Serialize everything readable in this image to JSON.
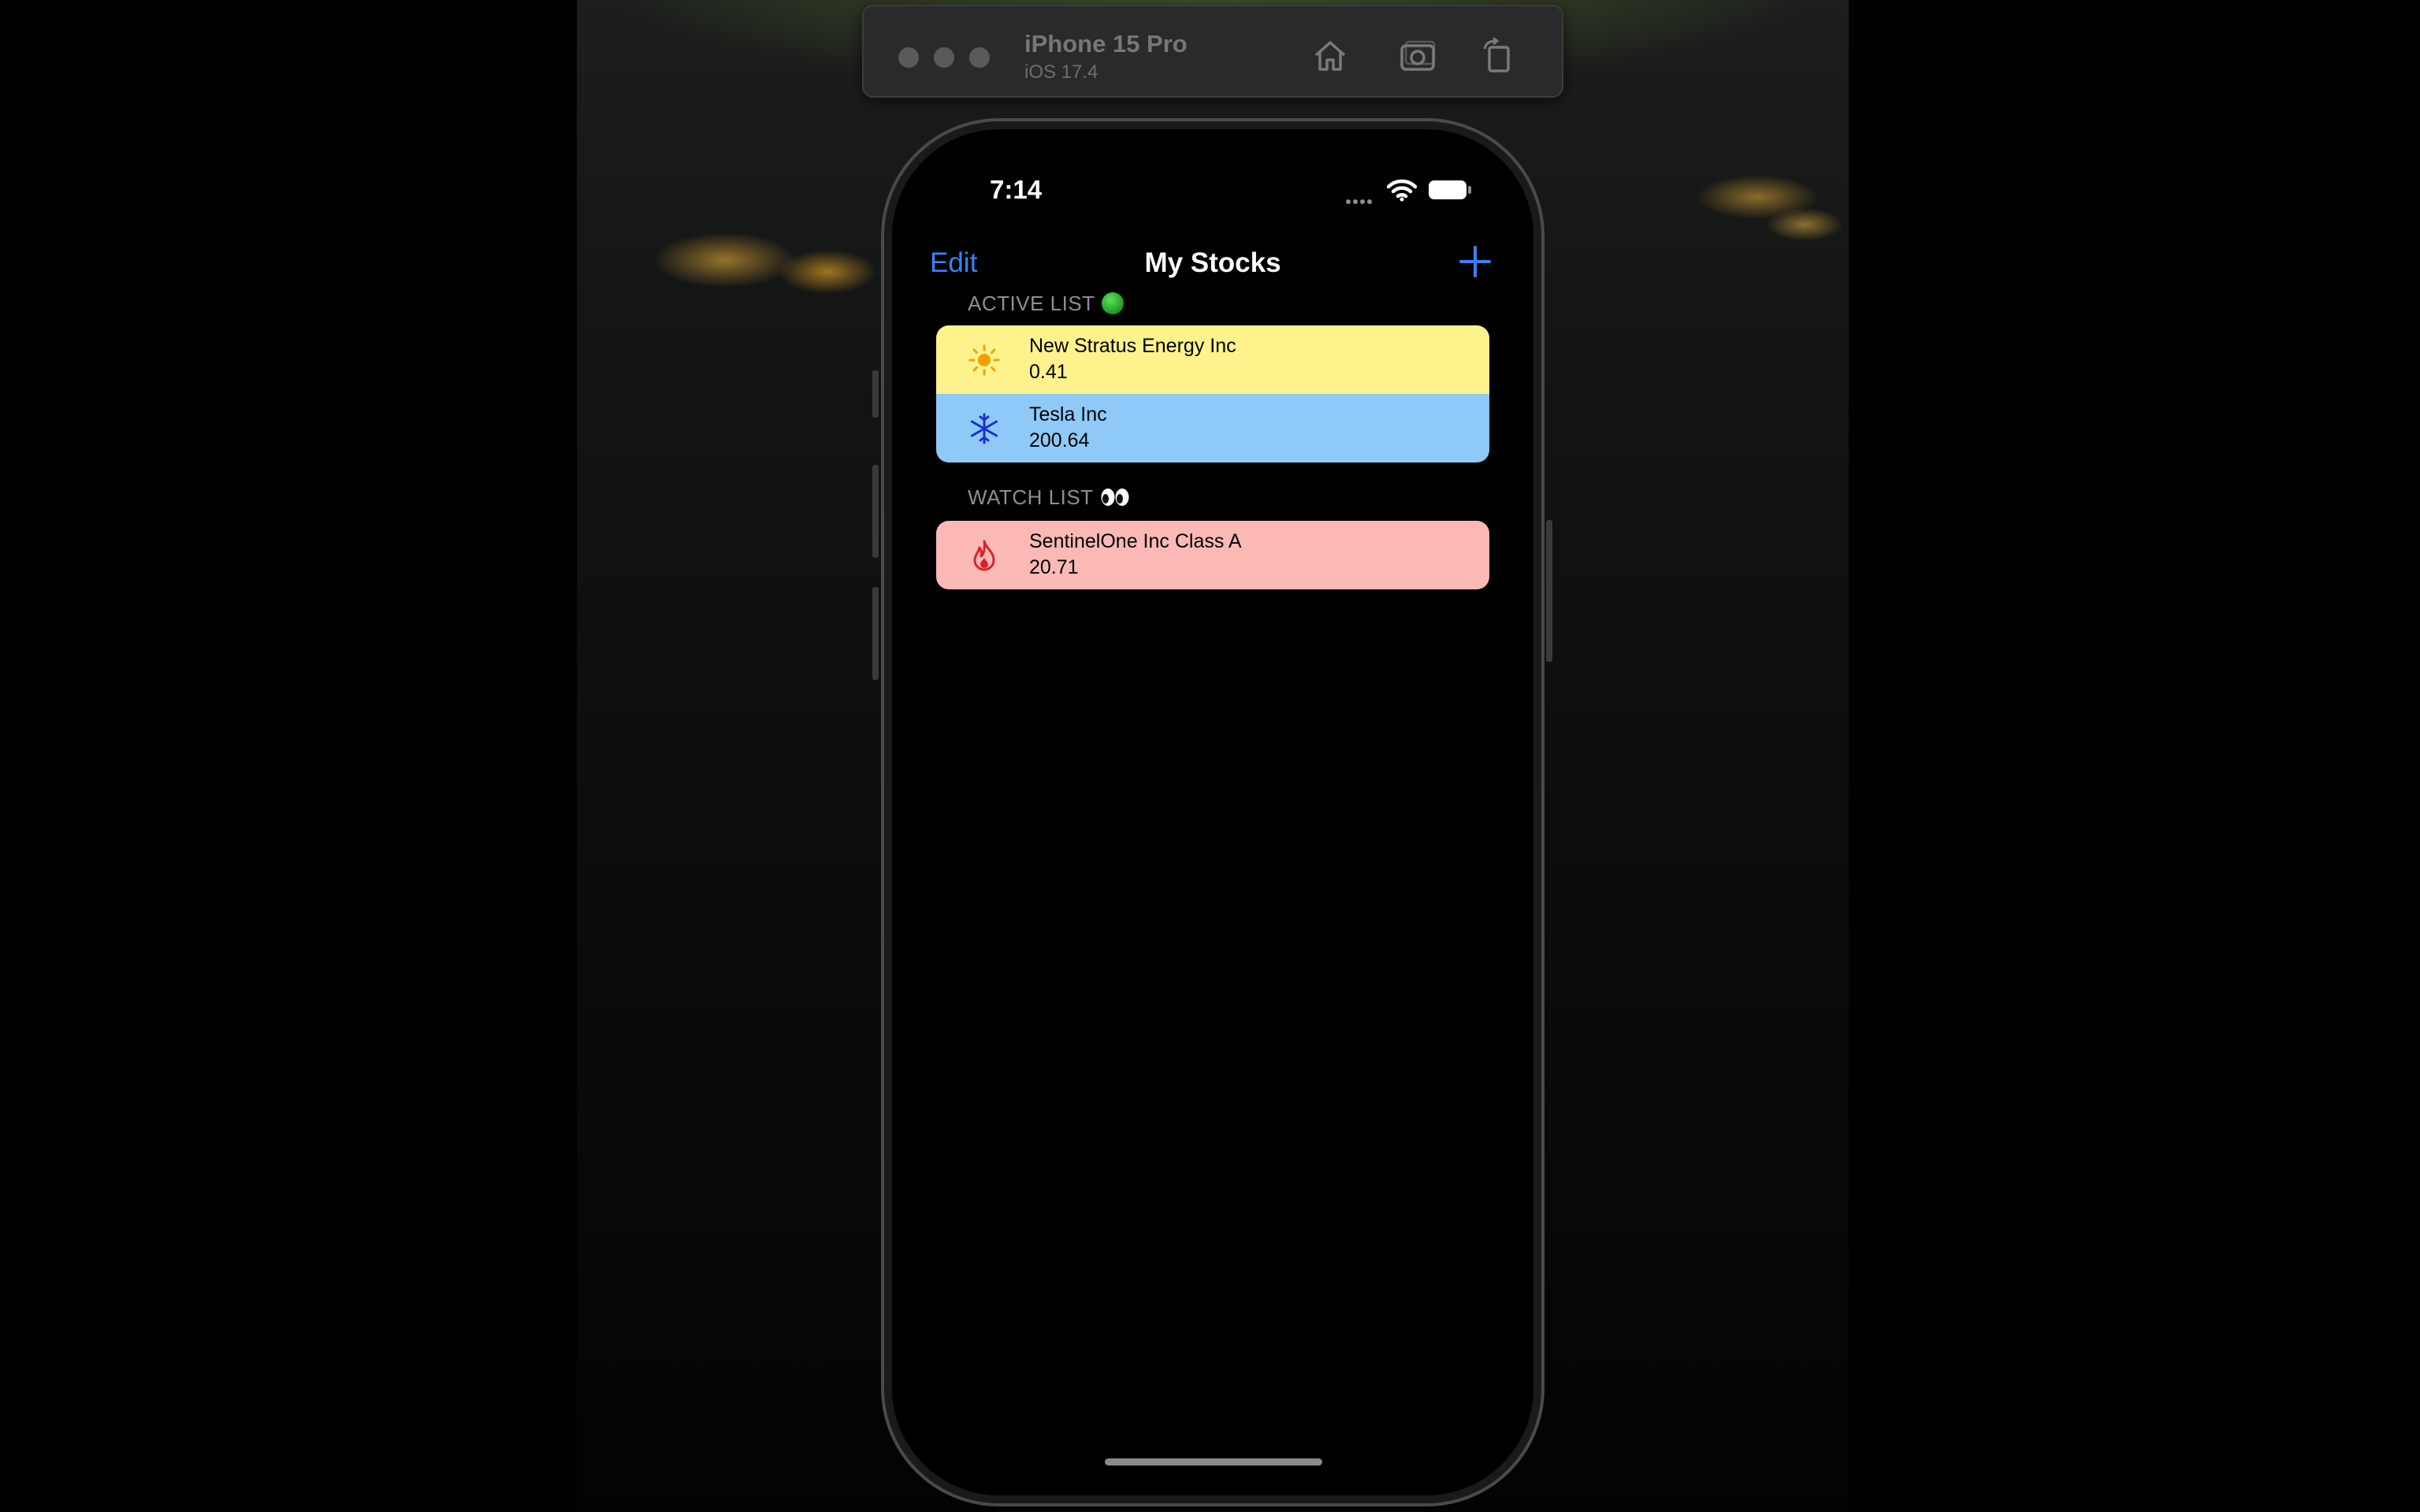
{
  "simulator": {
    "device_name": "iPhone 15 Pro",
    "os_version": "iOS 17.4",
    "toolbar_icons": [
      "home-icon",
      "screenshot-icon",
      "rotate-icon"
    ]
  },
  "status_bar": {
    "time": "7:14"
  },
  "nav": {
    "edit_label": "Edit",
    "title": "My Stocks",
    "add_icon": "plus-icon",
    "accent_color": "#3a82f7"
  },
  "sections": [
    {
      "header": "ACTIVE LIST",
      "header_icon": "green-circle-emoji",
      "rows": [
        {
          "name": "New Stratus Energy Inc",
          "price": "0.41",
          "icon": "sun-icon",
          "background": "#fdf28b"
        },
        {
          "name": "Tesla Inc",
          "price": "200.64",
          "icon": "snowflake-icon",
          "background": "#8ec9f7"
        }
      ]
    },
    {
      "header": "WATCH LIST",
      "header_icon": "eyes-emoji",
      "rows": [
        {
          "name": "SentinelOne Inc Class A",
          "price": "20.71",
          "icon": "flame-icon",
          "background": "#fbb9b6"
        }
      ]
    }
  ]
}
